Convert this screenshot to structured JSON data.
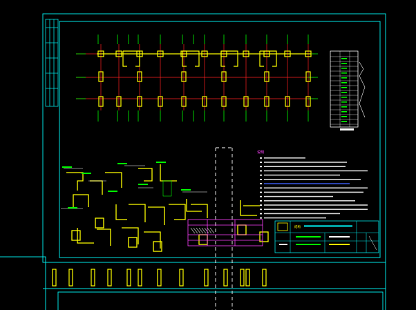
{
  "drawing": {
    "notes_heading": "说明",
    "title_block_stamp": "结构",
    "colors": {
      "background": "#000000",
      "frame": "#00e5e5",
      "axis_line": "#ff2020",
      "column": "#ffff00",
      "tick": "#00ff00",
      "white": "#ffffff",
      "magenta": "#ff40ff",
      "blue_text": "#4060ff"
    }
  }
}
